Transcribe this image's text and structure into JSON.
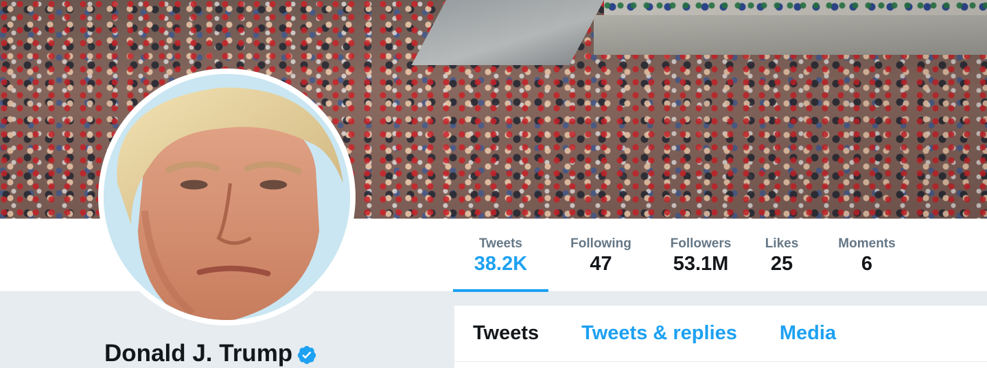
{
  "header": {
    "banner_icon": "crowd-photo",
    "avatar_icon": "profile-photo"
  },
  "nav": {
    "stats": [
      {
        "label": "Tweets",
        "value": "38.2K",
        "active": true
      },
      {
        "label": "Following",
        "value": "47"
      },
      {
        "label": "Followers",
        "value": "53.1M"
      },
      {
        "label": "Likes",
        "value": "25"
      },
      {
        "label": "Moments",
        "value": "6"
      }
    ]
  },
  "profile": {
    "name": "Donald J. Trump",
    "verified_icon": "verified-badge-icon"
  },
  "timeline": {
    "tabs": [
      {
        "label": "Tweets",
        "active": true
      },
      {
        "label": "Tweets & replies"
      },
      {
        "label": "Media"
      }
    ]
  },
  "colors": {
    "accent": "#1da1f2",
    "text_primary": "#14171a",
    "text_secondary": "#657786",
    "page_background": "#e6ecf0"
  }
}
